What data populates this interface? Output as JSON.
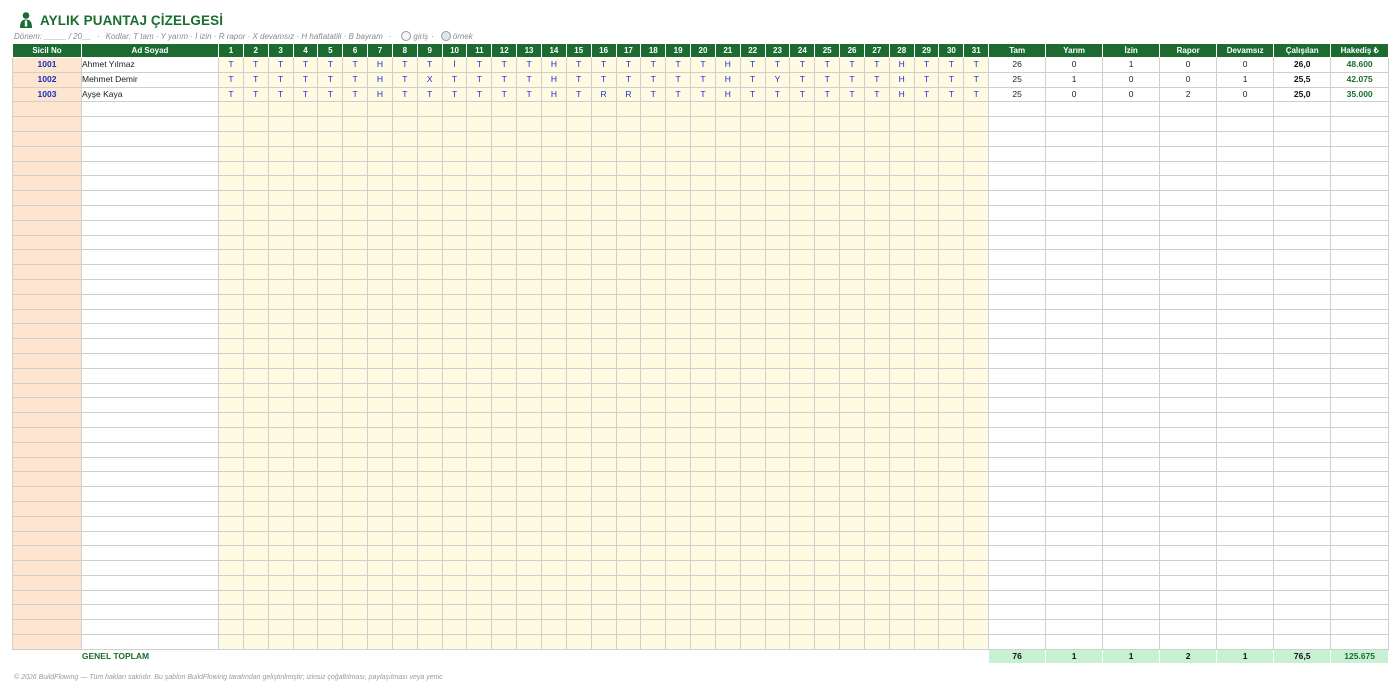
{
  "header": {
    "title": "AYLIK PUANTAJ ÇİZELGESİ",
    "icon": "person-icon",
    "donem_label": "Dönem: _____ / 20__",
    "kodlar_label": "Kodlar:  T tam · Y yarım · İ izin · R rapor · X devamsız · H haftatatili · B bayram",
    "legend_giris": "giriş",
    "legend_ornek": "örnek",
    "separator": "·"
  },
  "columns": {
    "sicil": "Sicil No",
    "ad": "Ad Soyad",
    "days": [
      "1",
      "2",
      "3",
      "4",
      "5",
      "6",
      "7",
      "8",
      "9",
      "10",
      "11",
      "12",
      "13",
      "14",
      "15",
      "16",
      "17",
      "18",
      "19",
      "20",
      "21",
      "22",
      "23",
      "24",
      "25",
      "26",
      "27",
      "28",
      "29",
      "30",
      "31"
    ],
    "tam": "Tam",
    "yarim": "Yarım",
    "izin": "İzin",
    "rapor": "Rapor",
    "devamsiz": "Devamsız",
    "calisilan": "Çalışılan",
    "hakedis": "Hakediş ₺"
  },
  "rows": [
    {
      "sicil": "1001",
      "ad": "Ahmet Yılmaz",
      "days": [
        "T",
        "T",
        "T",
        "T",
        "T",
        "T",
        "H",
        "T",
        "T",
        "İ",
        "T",
        "T",
        "T",
        "H",
        "T",
        "T",
        "T",
        "T",
        "T",
        "T",
        "H",
        "T",
        "T",
        "T",
        "T",
        "T",
        "T",
        "H",
        "T",
        "T",
        "T"
      ],
      "tam": "26",
      "yarim": "0",
      "izin": "1",
      "rapor": "0",
      "devamsiz": "0",
      "calisilan": "26,0",
      "hakedis": "48.600"
    },
    {
      "sicil": "1002",
      "ad": "Mehmet Demir",
      "days": [
        "T",
        "T",
        "T",
        "T",
        "T",
        "T",
        "H",
        "T",
        "X",
        "T",
        "T",
        "T",
        "T",
        "H",
        "T",
        "T",
        "T",
        "T",
        "T",
        "T",
        "H",
        "T",
        "Y",
        "T",
        "T",
        "T",
        "T",
        "H",
        "T",
        "T",
        "T"
      ],
      "tam": "25",
      "yarim": "1",
      "izin": "0",
      "rapor": "0",
      "devamsiz": "1",
      "calisilan": "25,5",
      "hakedis": "42.075"
    },
    {
      "sicil": "1003",
      "ad": "Ayşe Kaya",
      "days": [
        "T",
        "T",
        "T",
        "T",
        "T",
        "T",
        "H",
        "T",
        "T",
        "T",
        "T",
        "T",
        "T",
        "H",
        "T",
        "R",
        "R",
        "T",
        "T",
        "T",
        "H",
        "T",
        "T",
        "T",
        "T",
        "T",
        "T",
        "H",
        "T",
        "T",
        "T"
      ],
      "tam": "25",
      "yarim": "0",
      "izin": "0",
      "rapor": "2",
      "devamsiz": "0",
      "calisilan": "25,0",
      "hakedis": "35.000"
    }
  ],
  "totals": {
    "label": "GENEL TOPLAM",
    "tam": "76",
    "yarim": "1",
    "izin": "1",
    "rapor": "2",
    "devamsiz": "1",
    "calisilan": "76,5",
    "hakedis": "125.675"
  },
  "footer": "© 2026 BuildFlowing — Tüm hakları saklıdır. Bu şablon BuildFlowing tarafından geliştirilmiştir; izinsiz çoğaltılması, paylaşılması veya yenic",
  "colors": {
    "header_green": "#1e6b32",
    "title_green": "#1a6e2e",
    "sicil_bg": "#fde5cf",
    "day_bg": "#fffbe3",
    "total_bg": "#c8f1d4",
    "code_blue": "#1f2ed3"
  }
}
